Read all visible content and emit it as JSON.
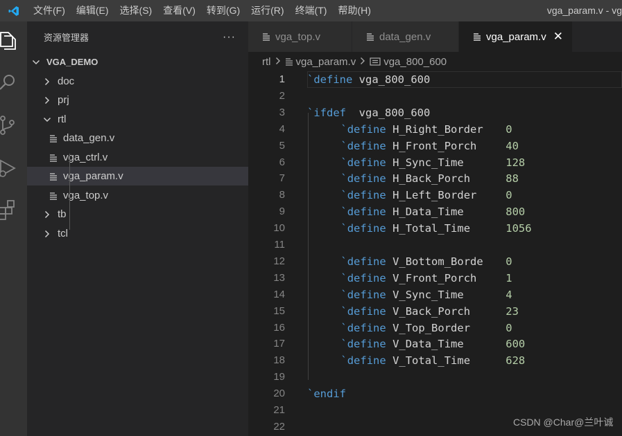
{
  "titlebar": {
    "menu": [
      "文件(F)",
      "编辑(E)",
      "选择(S)",
      "查看(V)",
      "转到(G)",
      "运行(R)",
      "终端(T)",
      "帮助(H)"
    ],
    "window_title": "vga_param.v - vg"
  },
  "activitybar": {
    "icons": [
      "explorer-icon",
      "search-icon",
      "source-control-icon",
      "run-debug-icon",
      "extensions-icon"
    ]
  },
  "sidebar": {
    "title": "资源管理器",
    "more": "···",
    "project": "VGA_DEMO",
    "tree": [
      {
        "label": "doc",
        "type": "folder",
        "expanded": false
      },
      {
        "label": "prj",
        "type": "folder",
        "expanded": false
      },
      {
        "label": "rtl",
        "type": "folder",
        "expanded": true
      },
      {
        "label": "data_gen.v",
        "type": "file"
      },
      {
        "label": "vga_ctrl.v",
        "type": "file"
      },
      {
        "label": "vga_param.v",
        "type": "file",
        "selected": true
      },
      {
        "label": "vga_top.v",
        "type": "file"
      },
      {
        "label": "tb",
        "type": "folder",
        "expanded": false
      },
      {
        "label": "tcl",
        "type": "folder",
        "expanded": false
      }
    ]
  },
  "tabs": [
    {
      "label": "vga_top.v",
      "active": false
    },
    {
      "label": "data_gen.v",
      "active": false
    },
    {
      "label": "vga_param.v",
      "active": true,
      "close": "✕"
    }
  ],
  "breadcrumb": {
    "folder": "rtl",
    "file": "vga_param.v",
    "symbol": "vga_800_600"
  },
  "editor": {
    "lines": [
      {
        "n": "1",
        "kw": "`define",
        "name": "vga_800_600",
        "val": "",
        "indent": 0
      },
      {
        "n": "2",
        "kw": "",
        "name": "",
        "val": "",
        "indent": 0
      },
      {
        "n": "3",
        "kw": "`ifdef",
        "name": " vga_800_600",
        "val": "",
        "indent": 0
      },
      {
        "n": "4",
        "kw": "`define",
        "name": "H_Right_Border",
        "val": "0",
        "indent": 1
      },
      {
        "n": "5",
        "kw": "`define",
        "name": "H_Front_Porch",
        "val": "40",
        "indent": 1
      },
      {
        "n": "6",
        "kw": "`define",
        "name": "H_Sync_Time",
        "val": "128",
        "indent": 1
      },
      {
        "n": "7",
        "kw": "`define",
        "name": "H_Back_Porch",
        "val": "88",
        "indent": 1
      },
      {
        "n": "8",
        "kw": "`define",
        "name": "H_Left_Border",
        "val": "0",
        "indent": 1
      },
      {
        "n": "9",
        "kw": "`define",
        "name": "H_Data_Time",
        "val": "800",
        "indent": 1
      },
      {
        "n": "10",
        "kw": "`define",
        "name": "H_Total_Time",
        "val": "1056",
        "indent": 1
      },
      {
        "n": "11",
        "kw": "",
        "name": "",
        "val": "",
        "indent": 0
      },
      {
        "n": "12",
        "kw": "`define",
        "name": "V_Bottom_Borde",
        "val": "0",
        "indent": 1
      },
      {
        "n": "13",
        "kw": "`define",
        "name": "V_Front_Porch",
        "val": "1",
        "indent": 1
      },
      {
        "n": "14",
        "kw": "`define",
        "name": "V_Sync_Time",
        "val": "4",
        "indent": 1
      },
      {
        "n": "15",
        "kw": "`define",
        "name": "V_Back_Porch",
        "val": "23",
        "indent": 1
      },
      {
        "n": "16",
        "kw": "`define",
        "name": "V_Top_Border",
        "val": "0",
        "indent": 1
      },
      {
        "n": "17",
        "kw": "`define",
        "name": "V_Data_Time",
        "val": "600",
        "indent": 1
      },
      {
        "n": "18",
        "kw": "`define",
        "name": "V_Total_Time",
        "val": "628",
        "indent": 1
      },
      {
        "n": "19",
        "kw": "",
        "name": "",
        "val": "",
        "indent": 0
      },
      {
        "n": "20",
        "kw": "`endif",
        "name": "",
        "val": "",
        "indent": 0
      },
      {
        "n": "21",
        "kw": "",
        "name": "",
        "val": "",
        "indent": 0
      },
      {
        "n": "22",
        "kw": "",
        "name": "",
        "val": "",
        "indent": 0
      }
    ]
  },
  "watermark": "CSDN @Char@兰叶诚",
  "colors": {
    "keyword": "#569cd6",
    "identifier": "#d4d4d4",
    "number": "#b5cea8",
    "logo": "#23a9f2"
  }
}
